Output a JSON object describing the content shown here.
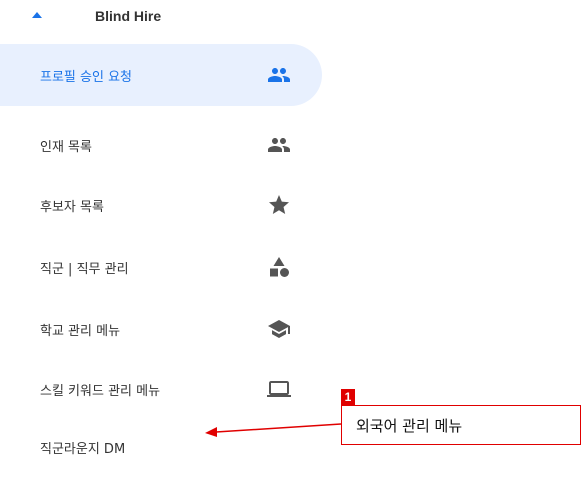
{
  "group": {
    "title": "Blind Hire",
    "expanded": true
  },
  "nav": {
    "items": [
      {
        "label": "프로필 승인 요청",
        "icon": "people-icon",
        "active": true
      },
      {
        "label": "인재 목록",
        "icon": "people-icon",
        "active": false
      },
      {
        "label": "후보자 목록",
        "icon": "star-icon",
        "active": false
      },
      {
        "label": "직군 | 직무 관리",
        "icon": "shapes-icon",
        "active": false
      },
      {
        "label": "학교 관리 메뉴",
        "icon": "school-icon",
        "active": false
      },
      {
        "label": "스킬 키워드 관리 메뉴",
        "icon": "laptop-icon",
        "active": false
      },
      {
        "label": "직군라운지 DM",
        "icon": "",
        "active": false
      }
    ]
  },
  "annotation": {
    "badge": "1",
    "text": "외국어 관리 메뉴"
  },
  "colors": {
    "accent": "#1a73e8",
    "active_bg": "#e8f0fe",
    "icon_gray": "#555555",
    "annotation_red": "#e00000"
  }
}
